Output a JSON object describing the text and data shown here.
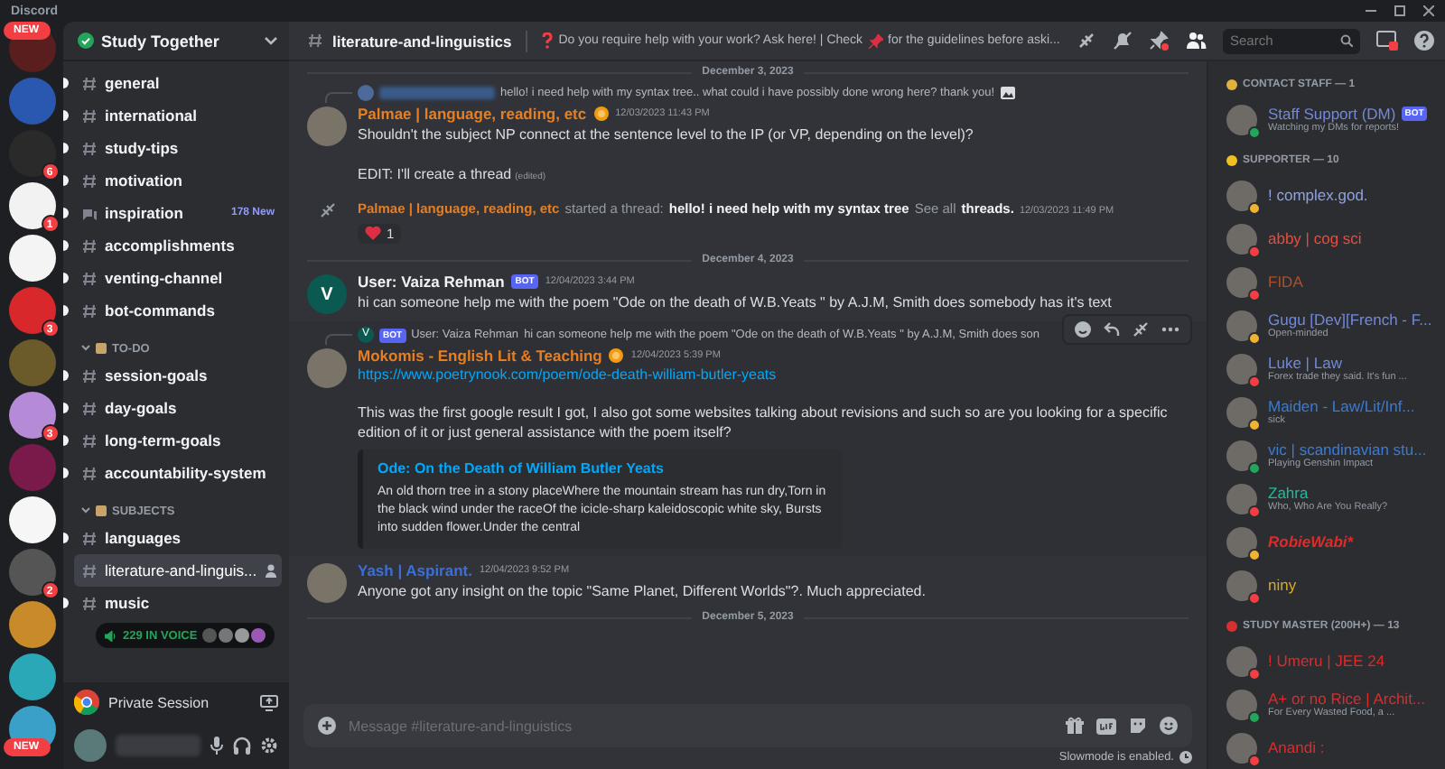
{
  "app": {
    "title": "Discord"
  },
  "servers": [
    {
      "color": "#5a1e1e",
      "new_pill": "NEW"
    },
    {
      "color": "#2a58b0"
    },
    {
      "color": "#2a2a2a",
      "badge": "6"
    },
    {
      "color": "#f2f2f2",
      "badge": "1"
    },
    {
      "color": "#f4f4f4"
    },
    {
      "color": "#d8282c",
      "badge": "3"
    },
    {
      "color": "#6b5a2a"
    },
    {
      "color": "#b58ad6",
      "badge": "3"
    },
    {
      "color": "#7a1a4a"
    },
    {
      "color": "#f6f6f6"
    },
    {
      "color": "#555555",
      "badge": "2"
    },
    {
      "color": "#c98a2a"
    },
    {
      "color": "#2aa8b8"
    },
    {
      "color": "#3aa0c8",
      "new_pill": "NEW"
    }
  ],
  "server_name": "Study Together",
  "channels": [
    {
      "kind": "text",
      "name": "general",
      "unread": true,
      "selected": false
    },
    {
      "kind": "text",
      "name": "international",
      "unread": true,
      "selected": false
    },
    {
      "kind": "text",
      "name": "study-tips",
      "unread": true,
      "selected": false
    },
    {
      "kind": "text",
      "name": "motivation",
      "unread": true,
      "selected": false
    },
    {
      "kind": "forum",
      "name": "inspiration",
      "unread": true,
      "selected": false,
      "new_count": "178 New"
    },
    {
      "kind": "text",
      "name": "accomplishments",
      "unread": true,
      "selected": false
    },
    {
      "kind": "text",
      "name": "venting-channel",
      "unread": true,
      "selected": false
    },
    {
      "kind": "text",
      "name": "bot-commands",
      "unread": true,
      "selected": false
    },
    {
      "kind": "category",
      "name": "TO-DO"
    },
    {
      "kind": "text",
      "name": "session-goals",
      "unread": true,
      "selected": false
    },
    {
      "kind": "text",
      "name": "day-goals",
      "unread": true,
      "selected": false
    },
    {
      "kind": "text",
      "name": "long-term-goals",
      "unread": true,
      "selected": false
    },
    {
      "kind": "text",
      "name": "accountability-system",
      "unread": true,
      "selected": false
    },
    {
      "kind": "category",
      "name": "SUBJECTS"
    },
    {
      "kind": "text",
      "name": "languages",
      "unread": true,
      "selected": false
    },
    {
      "kind": "text",
      "name": "literature-and-linguis...",
      "unread": false,
      "selected": true
    },
    {
      "kind": "text",
      "name": "music",
      "unread": true,
      "selected": false
    }
  ],
  "voice_pill": "229 IN VOICE",
  "activity": {
    "label": "Private Session"
  },
  "header": {
    "channel": "literature-and-linguistics",
    "topic_before": "Do you require help with your work? Ask here! | Check",
    "topic_after": "for the guidelines before aski...",
    "search_placeholder": "Search"
  },
  "messages": [
    {
      "kind": "date",
      "text": "December 3, 2023"
    },
    {
      "kind": "message",
      "reply": {
        "author_hidden": true,
        "text": "hello! i need help with my syntax tree.. what could i have possibly done wrong here? thank you!"
      },
      "author": "Palmae | language, reading, etc",
      "color": "#e67e22",
      "timestamp": "12/03/2023 11:43 PM",
      "paragraphs": [
        "Shouldn't the subject NP connect at the sentence level to the IP (or VP, depending on the level)?",
        "EDIT: I'll create a thread"
      ],
      "edited": "(edited)"
    },
    {
      "kind": "thread",
      "author": "Palmae | language, reading, etc",
      "color": "#e67e22",
      "action": "started a thread:",
      "thread": "hello! i need help with my syntax tree",
      "see_all": "See all",
      "threads": "threads.",
      "timestamp": "12/03/2023 11:49 PM",
      "reaction_count": "1"
    },
    {
      "kind": "date",
      "text": "December 4, 2023"
    },
    {
      "kind": "message",
      "avatar_letter": "V",
      "author": "User: Vaiza Rehman",
      "color": "#f2f3f5",
      "badge": "BOT",
      "timestamp": "12/04/2023 3:44 PM",
      "paragraphs": [
        "hi can someone help me with the poem \"Ode on the death of W.B.Yeats \" by A.J.M, Smith does somebody has it's  text"
      ]
    },
    {
      "kind": "message",
      "hovered": true,
      "reply": {
        "avatar_letter": "V",
        "badge": "BOT",
        "author": "User: Vaiza Rehman",
        "text": "hi can someone help me with the poem \"Ode on the death of W.B.Yeats \" by A.J.M, Smith does son"
      },
      "author": "Mokomis - English Lit & Teaching",
      "color": "#e67e22",
      "timestamp": "12/04/2023 5:39 PM",
      "link": "https://www.poetrynook.com/poem/ode-death-william-butler-yeats",
      "paragraphs": [
        "This was the first google result I got, I also got some websites talking about revisions and such so are you looking for a specific edition of it or just general assistance with the poem itself?"
      ],
      "embed": {
        "title": "Ode: On the Death of William Butler Yeats",
        "description": "An old thorn tree in a stony placeWhere the mountain stream has run dry,Torn in the black wind under the raceOf the icicle-sharp kaleidoscopic white sky, Bursts into sudden flower.Under the central"
      }
    },
    {
      "kind": "message",
      "author": "Yash | Aspirant.",
      "color": "#3b6fd6",
      "timestamp": "12/04/2023 9:52 PM",
      "paragraphs": [
        "Anyone got any insight on the topic \"Same Planet, Different Worlds\"?. Much appreciated."
      ]
    },
    {
      "kind": "date",
      "text": "December 5, 2023"
    }
  ],
  "composer": {
    "placeholder": "Message #literature-and-linguistics",
    "slowmode": "Slowmode is enabled."
  },
  "member_groups": [
    {
      "title": "CONTACT STAFF — 1",
      "members": [
        {
          "name": "Staff Support (DM)",
          "color": "#7289da",
          "badge": "BOT",
          "status_text": "Watching my DMs for reports!",
          "idle": false,
          "dnd": false
        }
      ]
    },
    {
      "title": "SUPPORTER — 10",
      "members": [
        {
          "name": "! complex.god.",
          "color": "#8ea1e1",
          "idle": true,
          "dnd": false
        },
        {
          "name": "abby | cog sci",
          "color": "#e74c3c",
          "idle": false,
          "dnd": true
        },
        {
          "name": "FIDA",
          "color": "#b0502a",
          "idle": false,
          "dnd": true
        },
        {
          "name": "Gugu [Dev][French - F...",
          "color": "#7289da",
          "status_text": "Open-minded",
          "idle": true,
          "dnd": false
        },
        {
          "name": "Luke | Law",
          "color": "#7289da",
          "status_text": "Forex trade they said. It's fun ...",
          "idle": false,
          "dnd": true
        },
        {
          "name": "Maiden - Law/Lit/Inf...",
          "color": "#3a7bd5",
          "status_text": "sick",
          "idle": true,
          "dnd": false
        },
        {
          "name": "vic | scandinavian stu...",
          "color": "#3a7bd5",
          "status_text": "Playing Genshin Impact",
          "idle": false,
          "dnd": false
        },
        {
          "name": "Zahra",
          "color": "#1abc9c",
          "status_text": "Who, Who Are You Really?",
          "idle": false,
          "dnd": true
        },
        {
          "name": "RobieWabi*",
          "color": "#e02a2a",
          "italic": true,
          "idle": true,
          "dnd": false
        },
        {
          "name": "niny",
          "color": "#d4a82a",
          "idle": false,
          "dnd": true
        }
      ]
    },
    {
      "title": "STUDY MASTER (200H+) — 13",
      "members": [
        {
          "name": "! Umeru | JEE 24",
          "color": "#e02a2a",
          "idle": false,
          "dnd": true
        },
        {
          "name": "A+ or no Rice | Archit...",
          "color": "#e02a2a",
          "status_text": "For Every Wasted Food, a ...",
          "idle": false,
          "dnd": false
        },
        {
          "name": "Anandi :",
          "color": "#e02a2a",
          "idle": false,
          "dnd": true
        }
      ]
    }
  ]
}
